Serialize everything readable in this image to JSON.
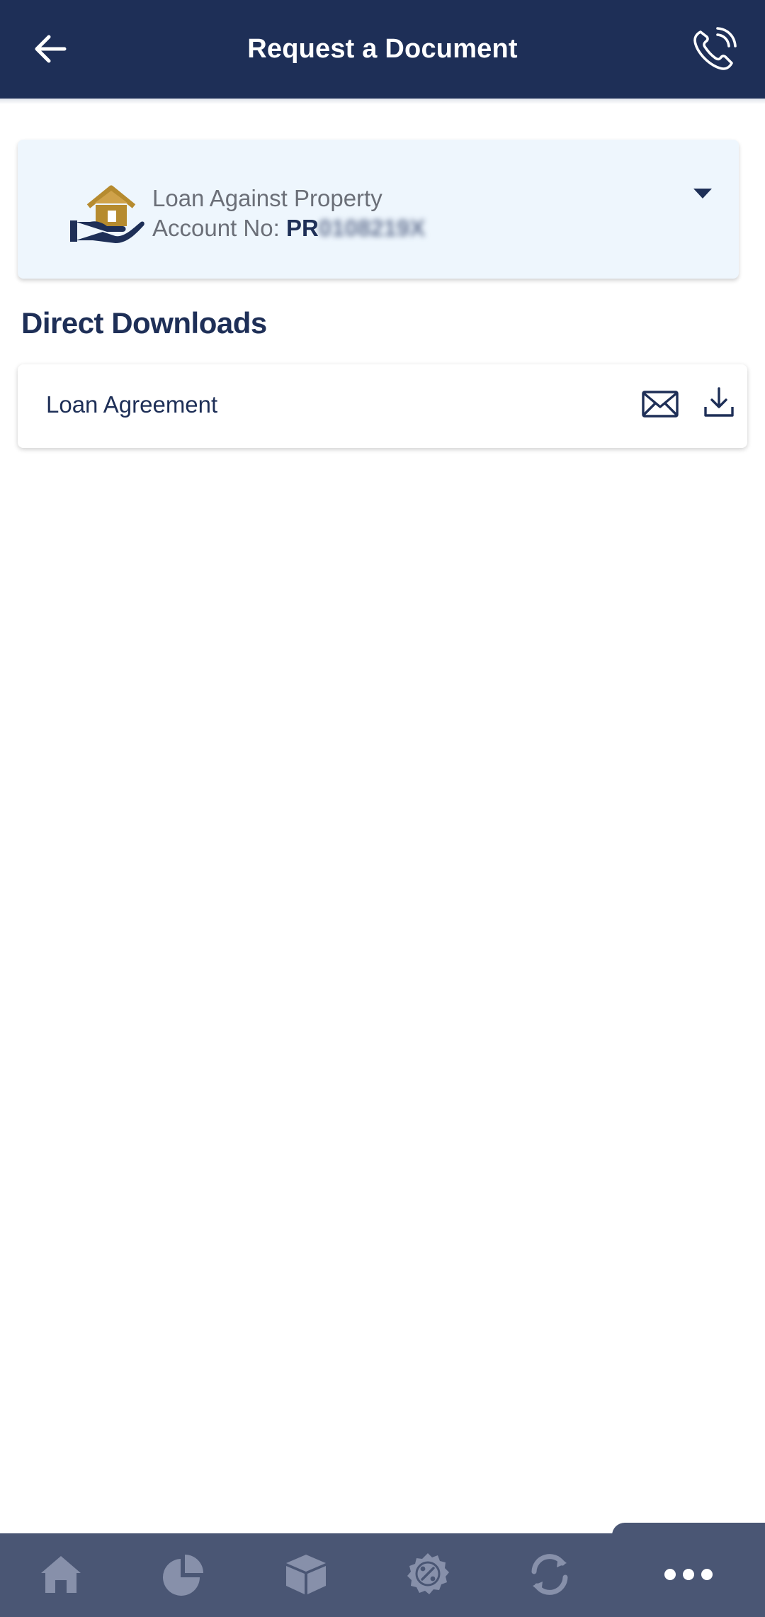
{
  "header": {
    "title": "Request a Document"
  },
  "account": {
    "type": "Loan Against Property",
    "label": "Account No:",
    "number_visible": "PR",
    "number_masked": "0108219X"
  },
  "section": {
    "title": "Direct Downloads"
  },
  "documents": [
    {
      "name": "Loan Agreement"
    }
  ],
  "colors": {
    "header_bg": "#1e2f57",
    "card_bg": "#eef6fd",
    "accent_gold": "#b68b2f",
    "nav_bg": "#4a5674",
    "nav_icon": "#8790aa"
  },
  "icons": {
    "back": "arrow-left-icon",
    "call": "phone-icon",
    "account": "home-hand-icon",
    "dropdown": "caret-down-icon",
    "mail": "mail-icon",
    "download": "download-icon",
    "nav": [
      "home-icon",
      "pie-chart-icon",
      "box-icon",
      "discount-badge-icon",
      "refresh-icon",
      "more-dots-icon"
    ]
  }
}
